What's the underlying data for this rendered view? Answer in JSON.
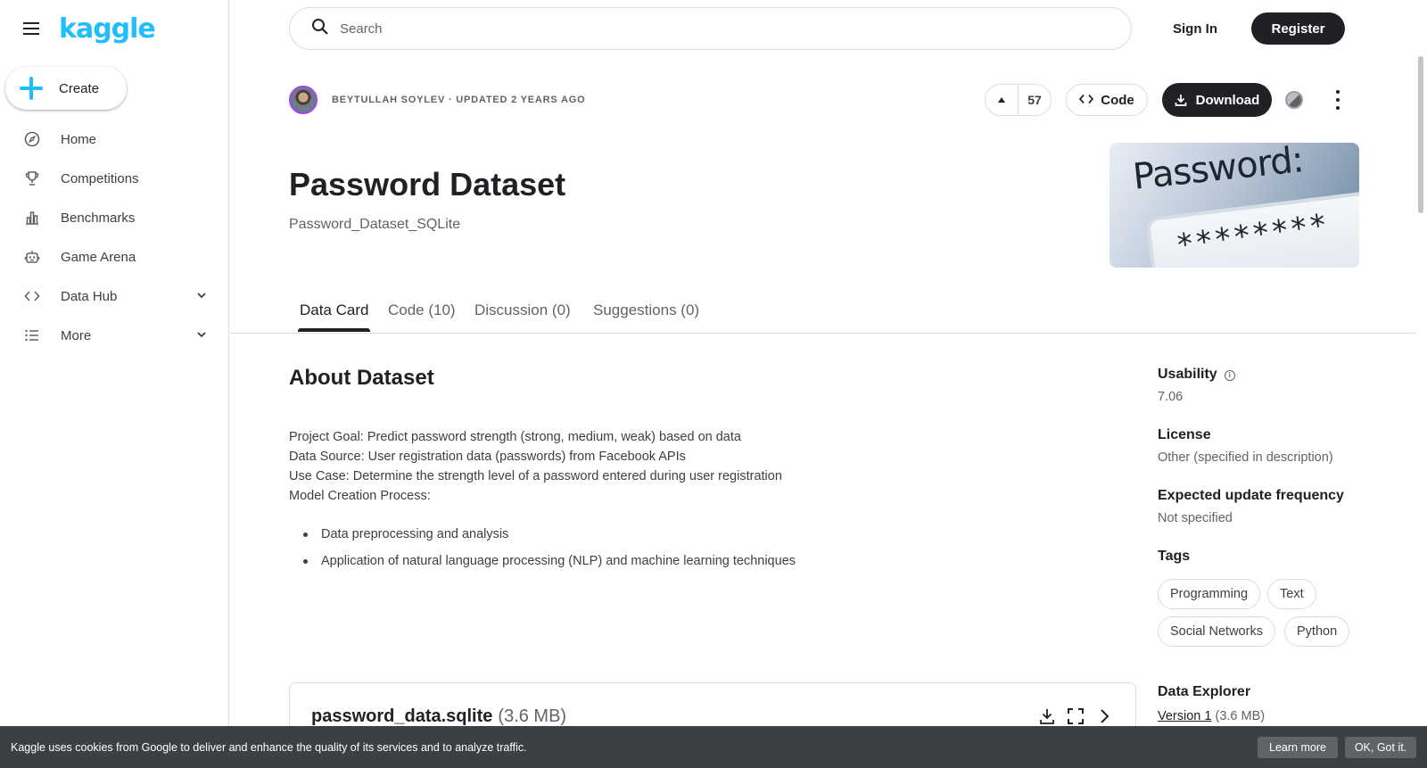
{
  "sidebar": {
    "logo": "kaggle",
    "create_label": "Create",
    "items": [
      {
        "label": "Home",
        "icon": "compass-icon"
      },
      {
        "label": "Competitions",
        "icon": "trophy-icon"
      },
      {
        "label": "Benchmarks",
        "icon": "bar-chart-icon"
      },
      {
        "label": "Game Arena",
        "icon": "robot-icon"
      },
      {
        "label": "Data Hub",
        "icon": "code-brackets-icon",
        "expandable": true
      },
      {
        "label": "More",
        "icon": "list-icon",
        "expandable": true
      }
    ]
  },
  "topbar": {
    "search_placeholder": "Search",
    "signin_label": "Sign In",
    "register_label": "Register"
  },
  "dataset": {
    "author_meta": "BEYTULLAH SOYLEV · UPDATED 2 YEARS AGO",
    "upvotes": "57",
    "code_label": "Code",
    "download_label": "Download",
    "title": "Password Dataset",
    "subtitle": "Password_Dataset_SQLite",
    "thumbnail": {
      "heading": "Password:",
      "mask": "********"
    }
  },
  "tabs": [
    {
      "label": "Data Card",
      "active": true
    },
    {
      "label": "Code (10)"
    },
    {
      "label": "Discussion (0)"
    },
    {
      "label": "Suggestions (0)"
    }
  ],
  "about": {
    "heading": "About Dataset",
    "lines": [
      "Project Goal: Predict password strength (strong, medium, weak) based on data",
      "Data Source: User registration data (passwords) from Facebook APIs",
      "Use Case: Determine the strength level of a password entered during user registration",
      "Model Creation Process:"
    ],
    "bullets": [
      "Data preprocessing and analysis",
      "Application of natural language processing (NLP) and machine learning techniques"
    ]
  },
  "file": {
    "name": "password_data.sqlite",
    "size": "(3.6 MB)"
  },
  "side_panel": {
    "usability_label": "Usability",
    "usability_value": "7.06",
    "license_label": "License",
    "license_value": "Other (specified in description)",
    "frequency_label": "Expected update frequency",
    "frequency_value": "Not specified",
    "tags_label": "Tags",
    "tags": [
      "Programming",
      "Text",
      "Social Networks",
      "Python"
    ],
    "explorer_label": "Data Explorer",
    "explorer_version": "Version 1",
    "explorer_size": "(3.6 MB)"
  },
  "cookie": {
    "message": "Kaggle uses cookies from Google to deliver and enhance the quality of its services and to analyze traffic.",
    "learn_more": "Learn more",
    "ok": "OK, Got it."
  },
  "colors": {
    "brand": "#20BEFF",
    "primary_button": "#202124",
    "cookie_bg": "#3C4043"
  }
}
